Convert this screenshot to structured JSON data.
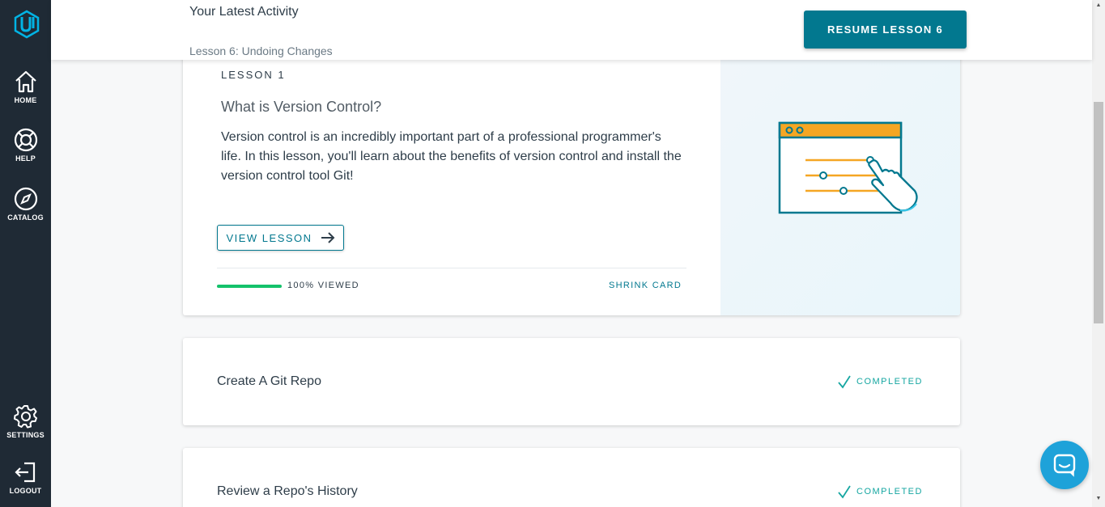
{
  "sidebar": {
    "logo": "udacity-logo-icon",
    "items": [
      {
        "label": "HOME",
        "icon": "home-icon"
      },
      {
        "label": "HELP",
        "icon": "lifebuoy-icon"
      },
      {
        "label": "CATALOG",
        "icon": "compass-icon"
      },
      {
        "label": "SETTINGS",
        "icon": "gear-icon"
      },
      {
        "label": "LOGOUT",
        "icon": "logout-icon"
      }
    ]
  },
  "header": {
    "title": "Your Latest Activity",
    "subtitle": "Lesson 6: Undoing Changes",
    "resume_label": "RESUME LESSON 6"
  },
  "lesson_card": {
    "number": "LESSON 1",
    "title": "What is Version Control?",
    "description": "Version control is an incredibly important part of a professional programmer's life. In this lesson, you'll learn about the benefits of version control and install the version control tool Git!",
    "view_label": "VIEW LESSON",
    "progress_percent": 100,
    "progress_text": "100% VIEWED",
    "shrink_label": "SHRINK CARD"
  },
  "lessons": [
    {
      "title": "Create A Git Repo",
      "status": "COMPLETED"
    },
    {
      "title": "Review a Repo's History",
      "status": "COMPLETED"
    }
  ],
  "colors": {
    "sidebar": "#1f2a35",
    "accent": "#02788f",
    "progress": "#15c26b",
    "completed": "#15a6a1",
    "chat": "#1ea2d9",
    "illustration_orange": "#f5a623"
  }
}
